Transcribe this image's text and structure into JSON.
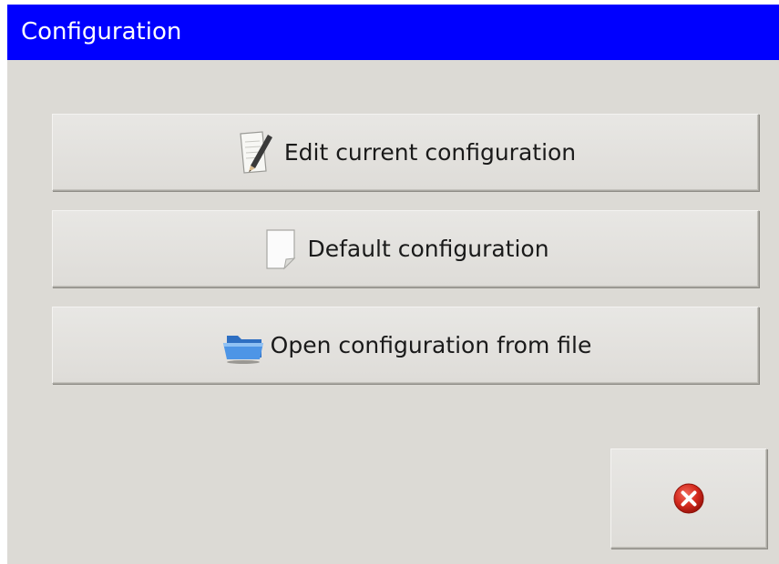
{
  "window": {
    "title": "Configuration"
  },
  "buttons": {
    "edit": {
      "label": "Edit current configuration",
      "icon": "edit-document-icon"
    },
    "default": {
      "label": "Default configuration",
      "icon": "blank-document-icon"
    },
    "open": {
      "label": "Open configuration from file",
      "icon": "open-folder-icon"
    },
    "close": {
      "icon": "close-icon"
    }
  },
  "colors": {
    "title_bar": "#0000ff",
    "window_bg": "#dcdad5",
    "close_red": "#d42a1e"
  }
}
